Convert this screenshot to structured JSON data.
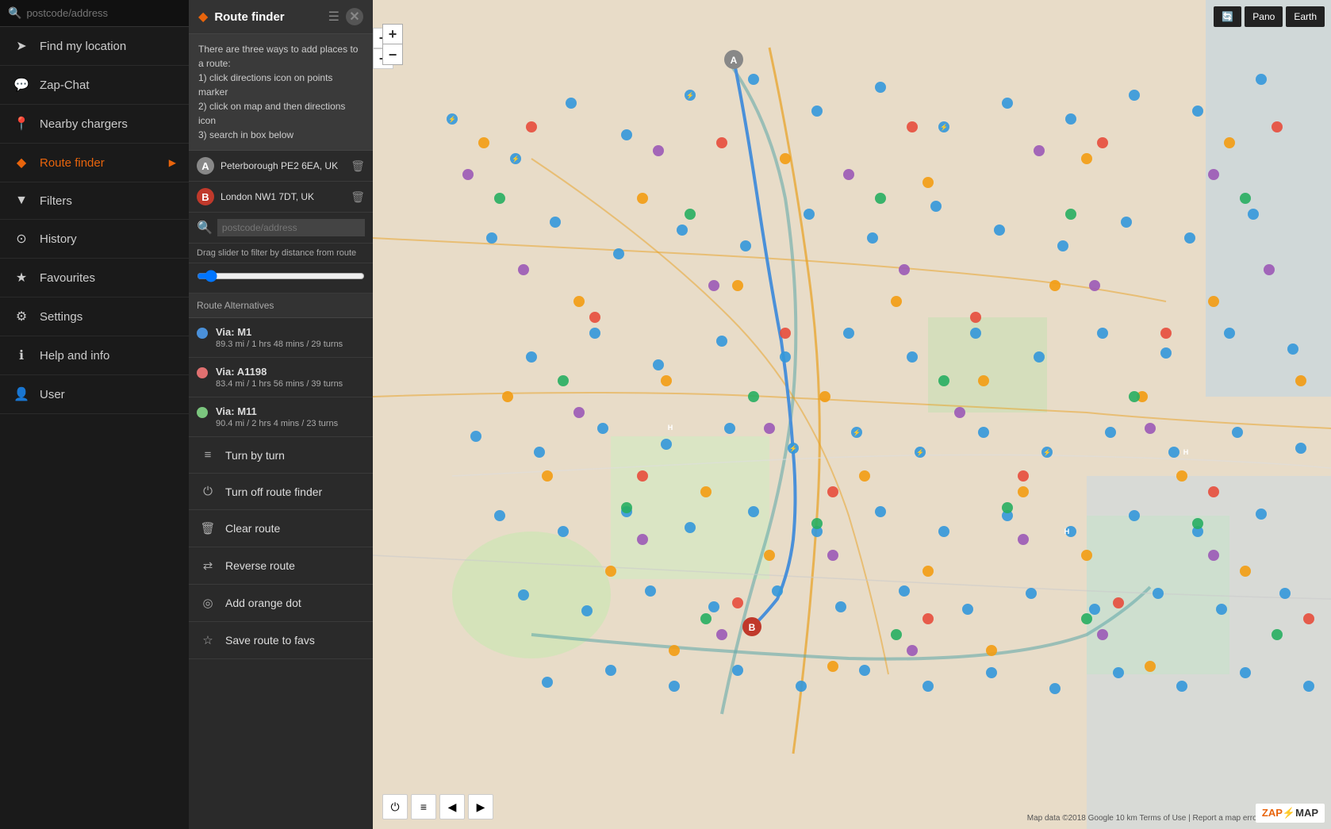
{
  "sidebar": {
    "title": "ZapMap",
    "search_placeholder": "postcode/address",
    "items": [
      {
        "id": "find-location",
        "label": "Find my location",
        "icon": "➤"
      },
      {
        "id": "zap-chat",
        "label": "Zap-Chat",
        "icon": "💬"
      },
      {
        "id": "nearby-chargers",
        "label": "Nearby chargers",
        "icon": "📍"
      },
      {
        "id": "route-finder",
        "label": "Route finder",
        "icon": "◆",
        "active": true,
        "has_arrow": true
      },
      {
        "id": "filters",
        "label": "Filters",
        "icon": "▼"
      },
      {
        "id": "history",
        "label": "History",
        "icon": "⊙"
      },
      {
        "id": "favourites",
        "label": "Favourites",
        "icon": "★"
      },
      {
        "id": "settings",
        "label": "Settings",
        "icon": "⚙"
      },
      {
        "id": "help-info",
        "label": "Help and info",
        "icon": "ℹ"
      },
      {
        "id": "user",
        "label": "User",
        "icon": "👤"
      }
    ]
  },
  "route_panel": {
    "title": "Route finder",
    "instructions": {
      "line1": "There are three ways to add places to a route:",
      "line2": "1) click directions icon on points marker",
      "line3": "2) click on map and then directions icon",
      "line4": "3) search in box below"
    },
    "waypoints": [
      {
        "label": "A",
        "address": "Peterborough PE2 6EA, UK",
        "color": "a"
      },
      {
        "label": "B",
        "address": "London NW1 7DT, UK",
        "color": "b"
      }
    ],
    "search_placeholder": "postcode/address",
    "slider_label": "Drag slider to filter by distance from route",
    "route_alternatives_header": "Route Alternatives",
    "alternatives": [
      {
        "via": "Via: M1",
        "details": "89.3 mi / 1 hrs 48 mins / 29 turns",
        "color": "#4a90d9"
      },
      {
        "via": "Via: A1198",
        "details": "83.4 mi / 1 hrs 56 mins / 39 turns",
        "color": "#e07070"
      },
      {
        "via": "Via: M11",
        "details": "90.4 mi / 2 hrs 4 mins / 23 turns",
        "color": "#7bc67e"
      }
    ],
    "actions": [
      {
        "id": "turn-by-turn",
        "label": "Turn by turn",
        "icon": "≡"
      },
      {
        "id": "turn-off-route-finder",
        "label": "Turn off route finder",
        "icon": "⏻"
      },
      {
        "id": "clear-route",
        "label": "Clear route",
        "icon": "🗑"
      },
      {
        "id": "reverse-route",
        "label": "Reverse route",
        "icon": "⇄"
      },
      {
        "id": "add-orange-dot",
        "label": "Add orange dot",
        "icon": "◎"
      },
      {
        "id": "save-route-to-favs",
        "label": "Save route to favs",
        "icon": "☆"
      }
    ]
  },
  "map_controls": {
    "zoom_in": "+",
    "zoom_out": "−",
    "top_right_buttons": [
      "🔄",
      "Pano",
      "Earth"
    ],
    "bottom_buttons": [
      "⏻",
      "≡",
      "◀",
      "▶"
    ]
  },
  "map": {
    "attribution": "Map data ©2018 Google  10 km  Terms of Use | Report a map error"
  },
  "zapmap_logo": "ZAP MAP"
}
